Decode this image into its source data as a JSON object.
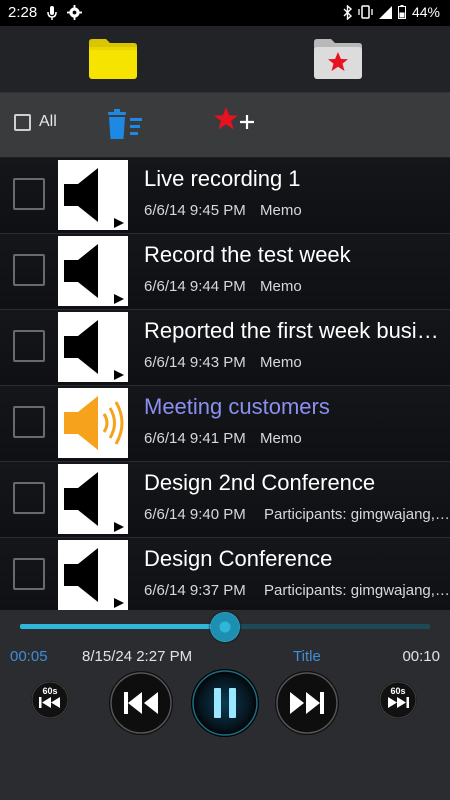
{
  "status_bar": {
    "time": "2:28",
    "battery_text": "44%"
  },
  "tabs": [
    {
      "name": "all-recordings",
      "icon": "folder-icon",
      "color": "#f6e400"
    },
    {
      "name": "favorites",
      "icon": "favorite-folder-icon",
      "color": "#dddddd"
    }
  ],
  "toolbar": {
    "select_all_label": "All",
    "delete_icon": "delete-list-icon",
    "add_favorite_icon": "star-plus-icon"
  },
  "recordings": [
    {
      "title": "Live recording 1",
      "date": "6/6/14 9:45 PM",
      "memo": "Memo",
      "active": false
    },
    {
      "title": "Record the test week",
      "date": "6/6/14 9:44 PM",
      "memo": "Memo",
      "active": false
    },
    {
      "title": "Reported the first week business",
      "date": "6/6/14 9:43 PM",
      "memo": "Memo",
      "active": false
    },
    {
      "title": "Meeting customers",
      "date": "6/6/14 9:41 PM",
      "memo": "Memo",
      "active": true
    },
    {
      "title": "Design 2nd Conference",
      "date": "6/6/14 9:40 PM",
      "memo": "Participants: gimgwajang, kim",
      "active": false
    },
    {
      "title": "Design Conference",
      "date": "6/6/14 9:37 PM",
      "memo": "Participants: gimgwajang, kim",
      "active": false
    }
  ],
  "player": {
    "progress_fraction": 0.5,
    "elapsed": "00:05",
    "recorded_date": "8/15/24 2:27 PM",
    "title_label": "Title",
    "total": "00:10",
    "skip_label": "60s",
    "accent_color": "#2fb6d8"
  }
}
